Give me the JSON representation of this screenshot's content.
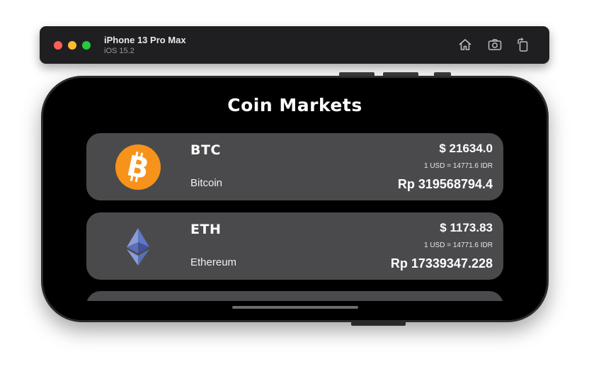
{
  "simulator": {
    "device_name": "iPhone 13 Pro Max",
    "os_version": "iOS 15.2",
    "buttons": [
      "home-icon",
      "screenshot-icon",
      "rotate-icon"
    ]
  },
  "app": {
    "title": "Coin Markets",
    "coins": [
      {
        "symbol": "BTC",
        "name": "Bitcoin",
        "price_usd": "$ 21634.0",
        "rate": "1 USD = 14771.6 IDR",
        "price_idr": "Rp 319568794.4",
        "icon": "bitcoin-icon",
        "color": "#f7931a"
      },
      {
        "symbol": "ETH",
        "name": "Ethereum",
        "price_usd": "$ 1173.83",
        "rate": "1 USD = 14771.6 IDR",
        "price_idr": "Rp 17339347.228",
        "icon": "ethereum-icon",
        "color": "#627eea"
      }
    ]
  },
  "colors": {
    "card_background": "#4a4a4c",
    "screen_background": "#000000",
    "toolbar_background": "#1f1f21"
  }
}
